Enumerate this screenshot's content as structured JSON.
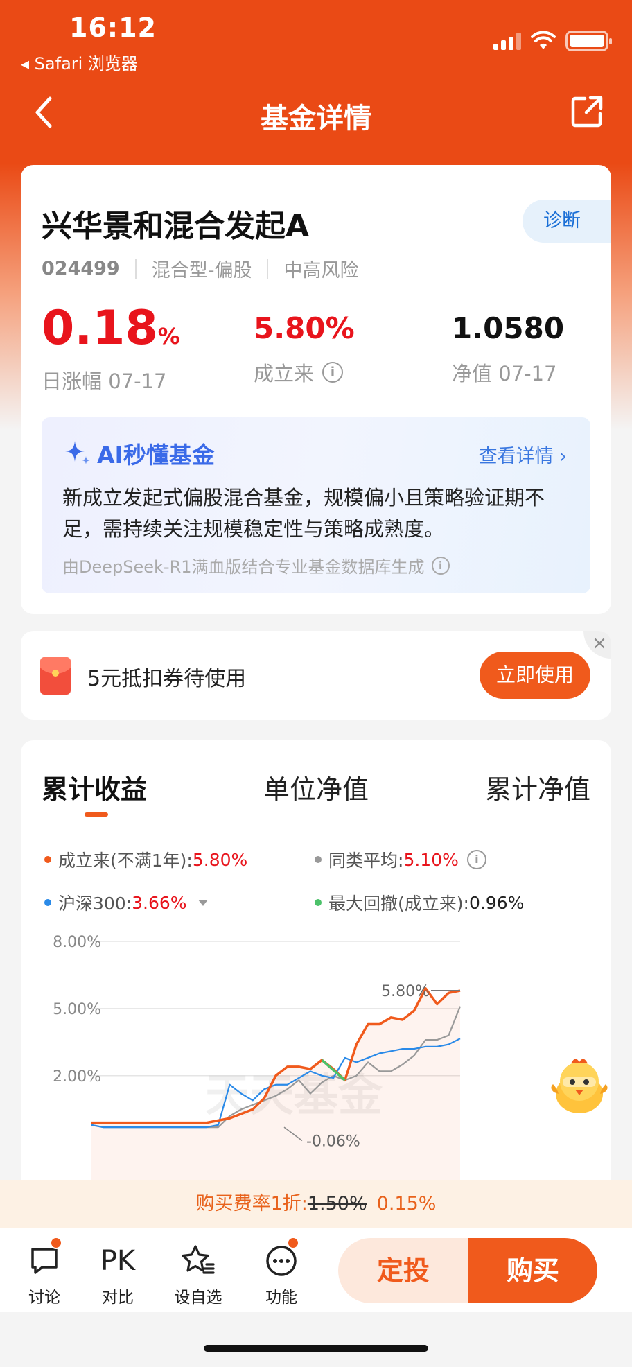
{
  "status_bar": {
    "time": "16:12",
    "back_app": "◂ Safari 浏览器"
  },
  "nav": {
    "title": "基金详情"
  },
  "fund": {
    "name": "兴华景和混合发起A",
    "diagnose_label": "诊断",
    "code": "024499",
    "type": "混合型-偏股",
    "risk": "中高风险",
    "daily_change_value": "0.18",
    "daily_change_unit": "%",
    "daily_change_label": "日涨幅 07-17",
    "since_inception_value": "5.80%",
    "since_inception_label": "成立来",
    "nav_value": "1.0580",
    "nav_label": "净值 07-17"
  },
  "ai": {
    "title": "AI秒懂基金",
    "more": "查看详情 ›",
    "summary": "新成立发起式偏股混合基金，规模偏小且策略验证期不足，需持续关注规模稳定性与策略成熟度。",
    "source": "由DeepSeek-R1满血版结合专业基金数据库生成"
  },
  "coupon": {
    "text": "5元抵扣券待使用",
    "button": "立即使用",
    "close": "×"
  },
  "chart_tabs": [
    "累计收益",
    "单位净值",
    "累计净值"
  ],
  "legend": {
    "fund": {
      "label": "成立来(不满1年):",
      "value": "5.80%",
      "color": "#f05a1c"
    },
    "peer": {
      "label": "同类平均:",
      "value": "5.10%",
      "color": "#999999"
    },
    "index": {
      "label": "沪深300:",
      "value": "3.66%",
      "color": "#2a8ae8"
    },
    "drawdown": {
      "label": "最大回撤(成立来):",
      "value": "0.96%",
      "color": "#4cc26a"
    }
  },
  "chart_data": {
    "type": "line",
    "y_ticks": [
      "8.00%",
      "5.00%",
      "2.00%"
    ],
    "ylim": [
      -2,
      8
    ],
    "annotations": [
      "5.80%",
      "-0.06%"
    ],
    "watermark": "天天基金",
    "series": [
      {
        "name": "成立来(不满1年)",
        "color": "#f05a1c",
        "values": [
          -0.1,
          -0.1,
          -0.1,
          -0.1,
          -0.1,
          -0.1,
          -0.1,
          -0.1,
          -0.1,
          -0.1,
          -0.1,
          0.0,
          0.1,
          0.3,
          0.5,
          1.0,
          2.0,
          2.4,
          2.4,
          2.3,
          2.7,
          2.3,
          1.8,
          3.4,
          4.3,
          4.3,
          4.6,
          4.5,
          4.9,
          5.9,
          5.2,
          5.7,
          5.8
        ]
      },
      {
        "name": "同类平均",
        "color": "#999999",
        "values": [
          -0.2,
          -0.3,
          -0.3,
          -0.3,
          -0.3,
          -0.3,
          -0.3,
          -0.3,
          -0.3,
          -0.3,
          -0.3,
          -0.3,
          0.2,
          0.5,
          0.7,
          0.9,
          1.1,
          1.4,
          1.8,
          1.2,
          1.7,
          2.0,
          1.8,
          2.0,
          2.6,
          2.2,
          2.2,
          2.5,
          2.9,
          3.6,
          3.6,
          3.8,
          5.1
        ]
      },
      {
        "name": "沪深300",
        "color": "#2a8ae8",
        "values": [
          -0.2,
          -0.3,
          -0.3,
          -0.3,
          -0.3,
          -0.3,
          -0.3,
          -0.3,
          -0.3,
          -0.3,
          -0.3,
          -0.2,
          1.6,
          1.2,
          0.9,
          1.4,
          1.6,
          1.6,
          1.9,
          2.2,
          2.0,
          1.9,
          2.8,
          2.6,
          2.8,
          3.0,
          3.1,
          3.2,
          3.2,
          3.3,
          3.3,
          3.4,
          3.66
        ]
      }
    ]
  },
  "fee": {
    "label": "购买费率1折:",
    "original": "1.50%",
    "discounted": "0.15%"
  },
  "bottom": {
    "discuss": "讨论",
    "compare_icon": "PK",
    "compare": "对比",
    "watchlist": "设自选",
    "functions": "功能",
    "invest_plan": "定投",
    "buy": "购买"
  }
}
